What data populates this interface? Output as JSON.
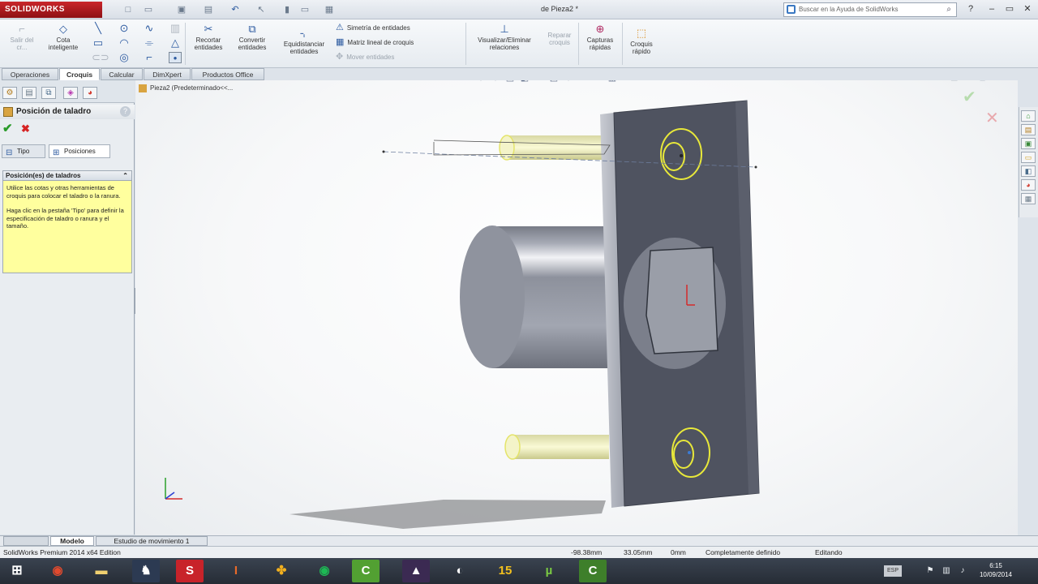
{
  "app": {
    "logo_text": "SOLIDWORKS",
    "document_title": "de Pieza2 *",
    "help_search_placeholder": "Buscar en la Ayuda de SolidWorks"
  },
  "ribbon": {
    "exit_sketch": "Salir del cr...",
    "smart_dim": "Cota inteligente",
    "trim": "Recortar entidades",
    "convert": "Convertir entidades",
    "offset": "Equidistanciar entidades",
    "mirror": "Simetría de entidades",
    "linear_pattern": "Matriz lineal de croquis",
    "move": "Mover entidades",
    "display_relations": "Visualizar/Eliminar relaciones",
    "repair": "Reparar croquis",
    "snaps": "Capturas rápidas",
    "rapid_sketch": "Croquis rápido"
  },
  "command_tabs": [
    "Operaciones",
    "Croquis",
    "Calcular",
    "DimXpert",
    "Productos Office"
  ],
  "active_command_tab": "Croquis",
  "property_manager": {
    "title": "Posición de taladro",
    "tab_type": "Tipo",
    "tab_positions": "Posiciones",
    "group_title": "Posición(es) de taladros",
    "message_1": "Utilice las cotas y otras herramientas de croquis para colocar el taladro o la ranura.",
    "message_2": "Haga clic en la pestaña 'Tipo' para definir la especificación de taladro o ranura y el tamaño."
  },
  "feature_tree": {
    "part_label": "Pieza2  (Predeterminado<<..."
  },
  "bottom_tabs": {
    "model": "Modelo",
    "motion": "Estudio de movimiento 1"
  },
  "status": {
    "edition": "SolidWorks Premium 2014 x64 Edition",
    "x": "-98.38mm",
    "y": "33.05mm",
    "z": "0mm",
    "state": "Completamente definido",
    "mode": "Editando"
  },
  "clock": {
    "time": "6:15",
    "date": "10/09/2014"
  },
  "colors": {
    "accent": "#c9262b",
    "ok": "#2a9b2a",
    "cancel": "#d62424",
    "note_bg": "#ffff9e",
    "plate": "#4f5360",
    "hole_highlight": "#e8e83a"
  }
}
